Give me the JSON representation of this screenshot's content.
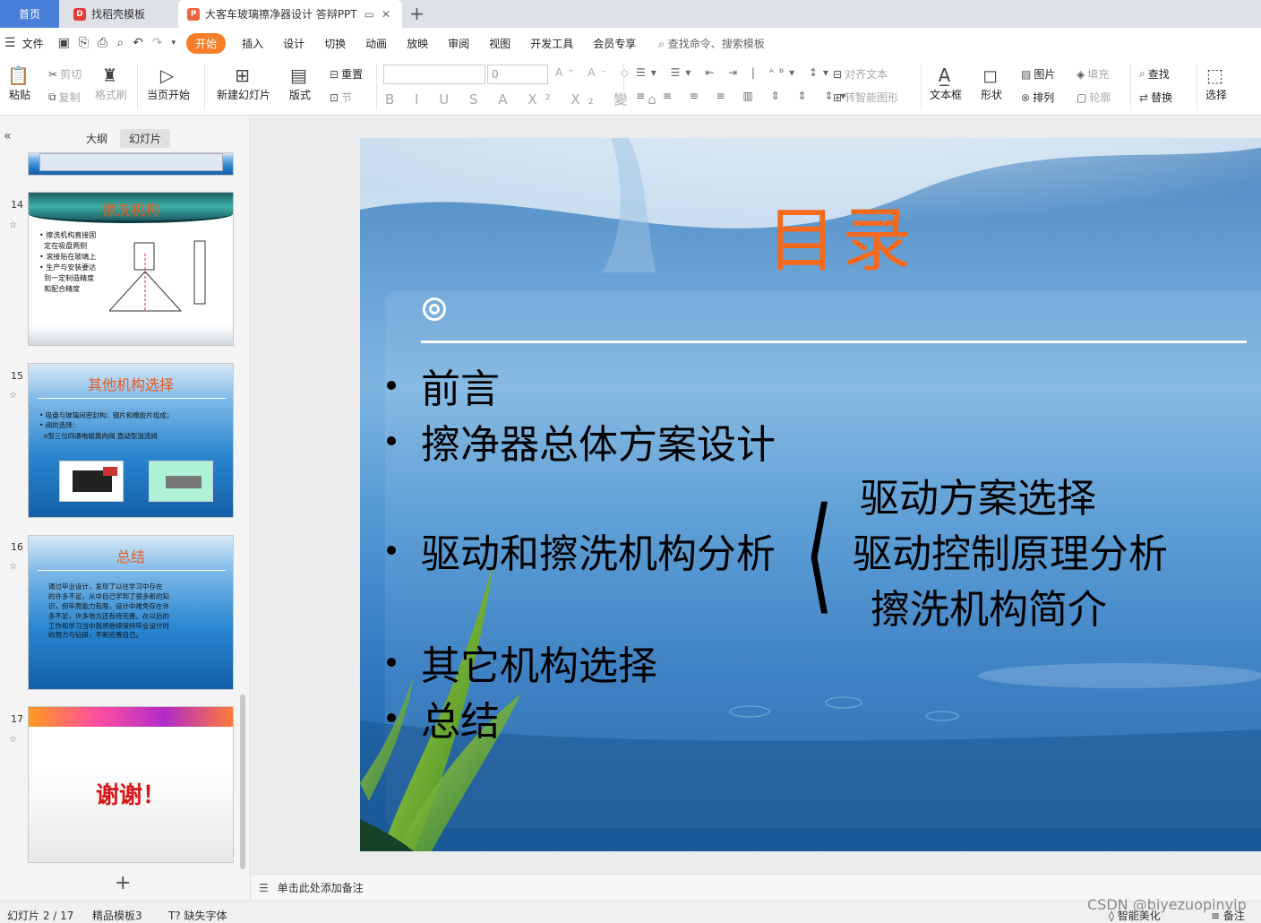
{
  "tabs": {
    "home": "首页",
    "t1": "找稻壳模板",
    "t2": "大客车玻璃擦净器设计 答辩PPT"
  },
  "menu": {
    "file": "文件",
    "items": [
      "开始",
      "插入",
      "设计",
      "切换",
      "动画",
      "放映",
      "审阅",
      "视图",
      "开发工具",
      "会员专享"
    ],
    "search": "查找命令、搜索模板"
  },
  "ribbon": {
    "paste": "粘贴",
    "cut": "剪切",
    "copy": "复制",
    "format_painter": "格式刷",
    "from_start": "当页开始",
    "new_slide": "新建幻灯片",
    "layout": "版式",
    "reset": "重置",
    "section": "节",
    "font_size": "0",
    "align_text": "对齐文本",
    "smart_art": "转智能图形",
    "textbox": "文本框",
    "shape": "形状",
    "picture": "图片",
    "arrange": "排列",
    "fill": "填充",
    "outline": "轮廓",
    "find": "查找",
    "replace": "替换",
    "select": "选择"
  },
  "panel": {
    "outline_tab": "大纲",
    "slides_tab": "幻灯片",
    "thumbs": [
      {
        "num": "14",
        "title": "擦洗机构",
        "text": "• 擦洗机构直接固\n  定在吸盘两侧\n• 滚接贴在玻璃上\n• 生产与安装要达\n  到一定制造精度\n  和配合精度"
      },
      {
        "num": "15",
        "title": "其他机构选择",
        "text": "• 吸盘与玻璃间密封构：钢片和橡胶片组成；\n• 阀的选择：\n  o型三位四通电磁换向阀 直动型溢流阀"
      },
      {
        "num": "16",
        "title": "总结",
        "text": "通过毕业设计，发现了以往学习中存在\n的许多不足，从中自己学到了很多新的知\n识，但毕竟能力有限，设计中难免存在许\n多不足，许多地方还有待完善。在以后的\n工作和学习当中我将继续保持毕业设计时\n的努力与钻研，不断完善自己。"
      },
      {
        "num": "17",
        "title": "谢谢！"
      }
    ]
  },
  "slide": {
    "title": "目录",
    "bullets": [
      "前言",
      "擦净器总体方案设计",
      "驱动和擦洗机构分析",
      "其它机构选择",
      "总结"
    ],
    "sub_items": [
      "驱动方案选择",
      "驱动控制原理分析",
      "擦洗机构简介"
    ]
  },
  "notes_placeholder": "单击此处添加备注",
  "status": {
    "slide_info": "幻灯片 2 / 17",
    "template": "精品模板3",
    "missing_font": "缺失字体",
    "beautify": "智能美化",
    "notes": "备注"
  },
  "watermark": "CSDN @biyezuopinvip",
  "colors": {
    "accent": "#f77f2c",
    "home_tab": "#4a7fd9",
    "slide_title": "#f36a1f"
  }
}
